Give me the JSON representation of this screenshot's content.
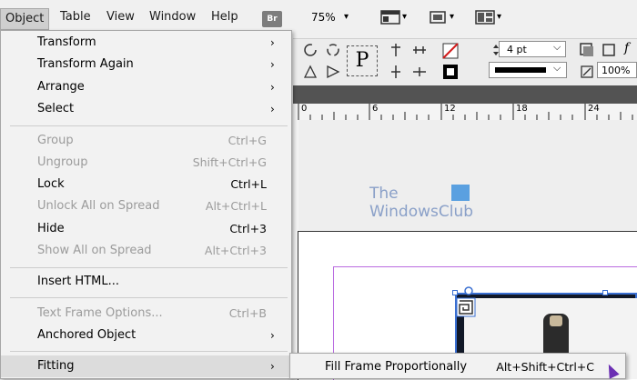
{
  "menubar": {
    "items": [
      {
        "label": "Object",
        "x": 0
      },
      {
        "label": "Table"
      },
      {
        "label": "View"
      },
      {
        "label": "Window"
      },
      {
        "label": "Help"
      }
    ],
    "bridge_label": "Br",
    "zoom": "75%",
    "caret": "▾"
  },
  "control_panel": {
    "frame_label": "P",
    "stroke_weight": "4 pt",
    "percent": "100%",
    "dropdown_caret": "⌵"
  },
  "ruler": {
    "labels": [
      "0",
      "6",
      "12",
      "18",
      "24"
    ]
  },
  "watermark": {
    "line1": "The",
    "line2": "WindowsClub"
  },
  "object_menu": {
    "items": [
      {
        "label": "Transform",
        "shortcut": "",
        "submenu": true,
        "disabled": false
      },
      {
        "label": "Transform Again",
        "shortcut": "",
        "submenu": true,
        "disabled": false
      },
      {
        "label": "Arrange",
        "shortcut": "",
        "submenu": true,
        "disabled": false
      },
      {
        "label": "Select",
        "shortcut": "",
        "submenu": true,
        "disabled": false
      },
      {
        "label": "Group",
        "shortcut": "Ctrl+G",
        "submenu": false,
        "disabled": true
      },
      {
        "label": "Ungroup",
        "shortcut": "Shift+Ctrl+G",
        "submenu": false,
        "disabled": true
      },
      {
        "label": "Lock",
        "shortcut": "Ctrl+L",
        "submenu": false,
        "disabled": false
      },
      {
        "label": "Unlock All on Spread",
        "shortcut": "Alt+Ctrl+L",
        "submenu": false,
        "disabled": true
      },
      {
        "label": "Hide",
        "shortcut": "Ctrl+3",
        "submenu": false,
        "disabled": false
      },
      {
        "label": "Show All on Spread",
        "shortcut": "Alt+Ctrl+3",
        "submenu": false,
        "disabled": true
      },
      {
        "label": "Insert HTML...",
        "shortcut": "",
        "submenu": false,
        "disabled": false
      },
      {
        "label": "Text Frame Options...",
        "shortcut": "Ctrl+B",
        "submenu": false,
        "disabled": true
      },
      {
        "label": "Anchored Object",
        "shortcut": "",
        "submenu": true,
        "disabled": false
      },
      {
        "label": "Fitting",
        "shortcut": "",
        "submenu": true,
        "disabled": false
      }
    ],
    "arrow": "›"
  },
  "fitting_submenu": {
    "item_label": "Fill Frame Proportionally",
    "item_shortcut": "Alt+Shift+Ctrl+C"
  },
  "colors": {
    "menu_bg": "#f2f2f2",
    "disabled_text": "#9b9b9b",
    "selection_blue": "#3a6fd1",
    "margin_purple": "#b96be0"
  }
}
